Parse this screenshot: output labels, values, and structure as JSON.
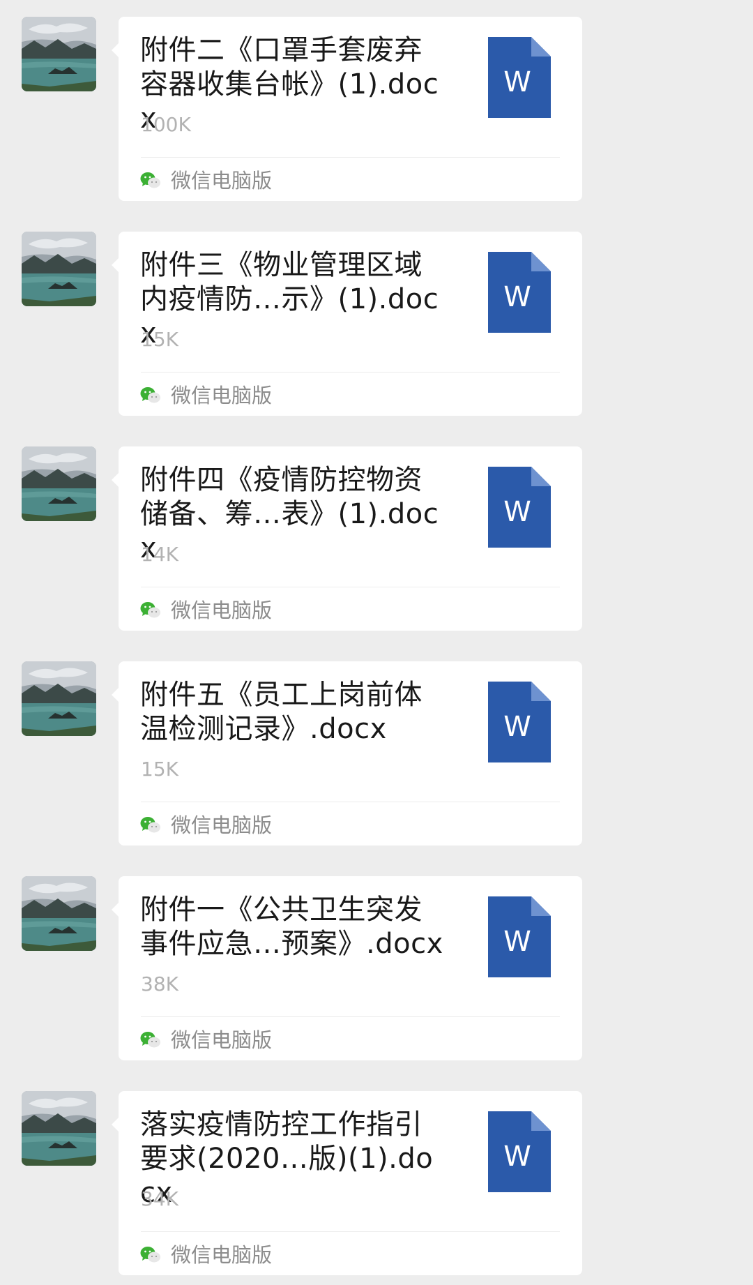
{
  "icons": {
    "avatar": "landscape-avatar-icon",
    "file": "word-doc-icon",
    "source": "wechat-icon"
  },
  "colors": {
    "background": "#ededed",
    "card": "#ffffff",
    "word_blue": "#2b5aaa",
    "wechat_green": "#3cb034",
    "size_gray": "#b2b2b2",
    "source_gray": "#8c8c8c"
  },
  "messages": [
    {
      "file_name": "附件二《口罩手套废弃容器收集台帐》(1).docx",
      "file_size": "100K",
      "file_icon_letter": "W",
      "source": "微信电脑版"
    },
    {
      "file_name": "附件三《物业管理区域内疫情防…示》(1).docx",
      "file_size": "15K",
      "file_icon_letter": "W",
      "source": "微信电脑版"
    },
    {
      "file_name": "附件四《疫情防控物资储备、筹…表》(1).docx",
      "file_size": "14K",
      "file_icon_letter": "W",
      "source": "微信电脑版"
    },
    {
      "file_name": "附件五《员工上岗前体温检测记录》.docx",
      "file_size": "15K",
      "file_icon_letter": "W",
      "source": "微信电脑版"
    },
    {
      "file_name": "附件一《公共卫生突发事件应急…预案》.docx",
      "file_size": "38K",
      "file_icon_letter": "W",
      "source": "微信电脑版"
    },
    {
      "file_name": "落实疫情防控工作指引要求(2020…版)(1).docx",
      "file_size": "34K",
      "file_icon_letter": "W",
      "source": "微信电脑版"
    }
  ]
}
